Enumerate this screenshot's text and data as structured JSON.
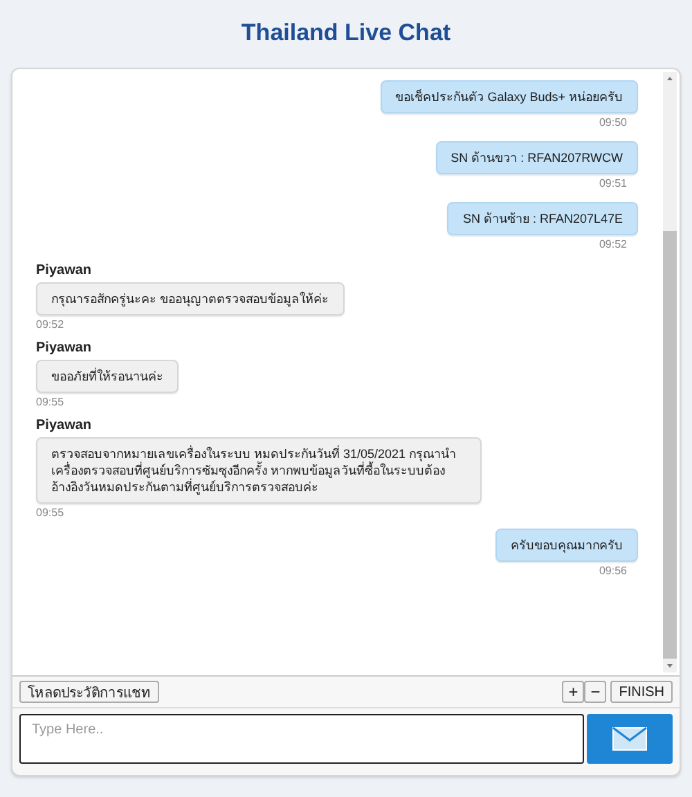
{
  "title": "Thailand Live Chat",
  "messages": [
    {
      "kind": "sent",
      "text": "ขอเช็คประกันตัว Galaxy Buds+ หน่อยครับ",
      "time": "09:50"
    },
    {
      "kind": "sent",
      "text": "SN ด้านขวา : RFAN207RWCW",
      "time": "09:51"
    },
    {
      "kind": "sent",
      "text": "SN ด้านซ้าย : RFAN207L47E",
      "time": "09:52"
    },
    {
      "kind": "received",
      "sender": "Piyawan",
      "text": "กรุณารอสักครู่นะคะ ขออนุญาตตรวจสอบข้อมูลให้ค่ะ",
      "time": "09:52"
    },
    {
      "kind": "received",
      "sender": "Piyawan",
      "text": "ขออภัยที่ให้รอนานค่ะ",
      "time": "09:55"
    },
    {
      "kind": "received",
      "sender": "Piyawan",
      "text": "ตรวจสอบจากหมายเลขเครื่องในระบบ หมดประกันวันที่ 31/05/2021 กรุณานำเครื่องตรวจสอบที่ศูนย์บริการซัมซุงอีกครั้ง หากพบข้อมูลวันที่ซื้อในระบบต้องอ้างอิงวันหมดประกันตามที่ศูนย์บริการตรวจสอบค่ะ",
      "time": "09:55"
    },
    {
      "kind": "sent",
      "text": "ครับขอบคุณมากครับ",
      "time": "09:56"
    }
  ],
  "toolbar": {
    "history_button": "โหลดประวัติการแชท",
    "zoom_in": "+",
    "zoom_out": "−",
    "finish_button": "FINISH"
  },
  "composer": {
    "placeholder": "Type Here.."
  }
}
